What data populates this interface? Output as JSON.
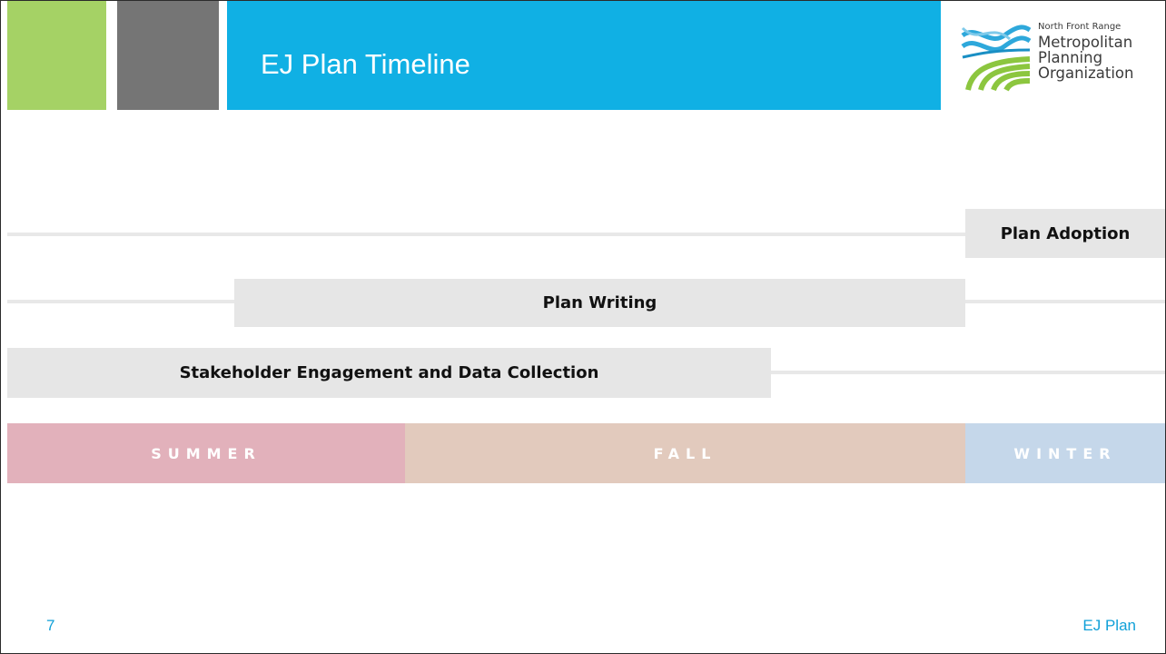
{
  "header": {
    "title": "EJ Plan Timeline",
    "colors": {
      "green": "#a5d265",
      "gray": "#757575",
      "blue": "#10b0e4"
    }
  },
  "logo": {
    "line1": "North Front Range",
    "line2": "Metropolitan",
    "line3": "Planning",
    "line4": "Organization",
    "icon": "nfrmpo-logo-icon"
  },
  "timeline": {
    "tasks": [
      {
        "label": "Plan Adoption"
      },
      {
        "label": "Plan Writing"
      },
      {
        "label": "Stakeholder Engagement and Data Collection"
      }
    ],
    "seasons": [
      {
        "label": "SUMMER",
        "color": "#e2b1bb"
      },
      {
        "label": "FALL",
        "color": "#e2cabd"
      },
      {
        "label": "WINTER",
        "color": "#c5d7ea"
      }
    ]
  },
  "footer": {
    "page_number": "7",
    "label": "EJ Plan"
  }
}
